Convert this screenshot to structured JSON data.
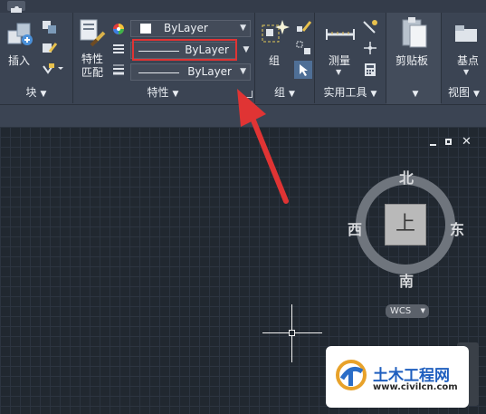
{
  "ribbon": {
    "panels": {
      "block": "块",
      "properties": "特性",
      "groups": "组",
      "utilities": "实用工具",
      "clipboard_footer": "",
      "view": "视图"
    },
    "insert_label": "插入",
    "match_properties_label": "特性匹配",
    "group_label": "组",
    "measure_label": "测量",
    "clipboard_label": "剪贴板",
    "base_label": "基点",
    "color_combo": "ByLayer",
    "linetype_combo": "ByLayer",
    "lineweight_combo": "ByLayer"
  },
  "viewcube": {
    "north": "北",
    "south": "南",
    "east": "东",
    "west": "西",
    "top_face": "上",
    "wcs_label": "WCS"
  },
  "watermark": {
    "brand": "土木工程网",
    "url": "www.civilcn.com"
  },
  "colors": {
    "ribbon_bg": "#3b4453",
    "canvas_bg": "#212830",
    "highlight_red": "#e03434"
  }
}
